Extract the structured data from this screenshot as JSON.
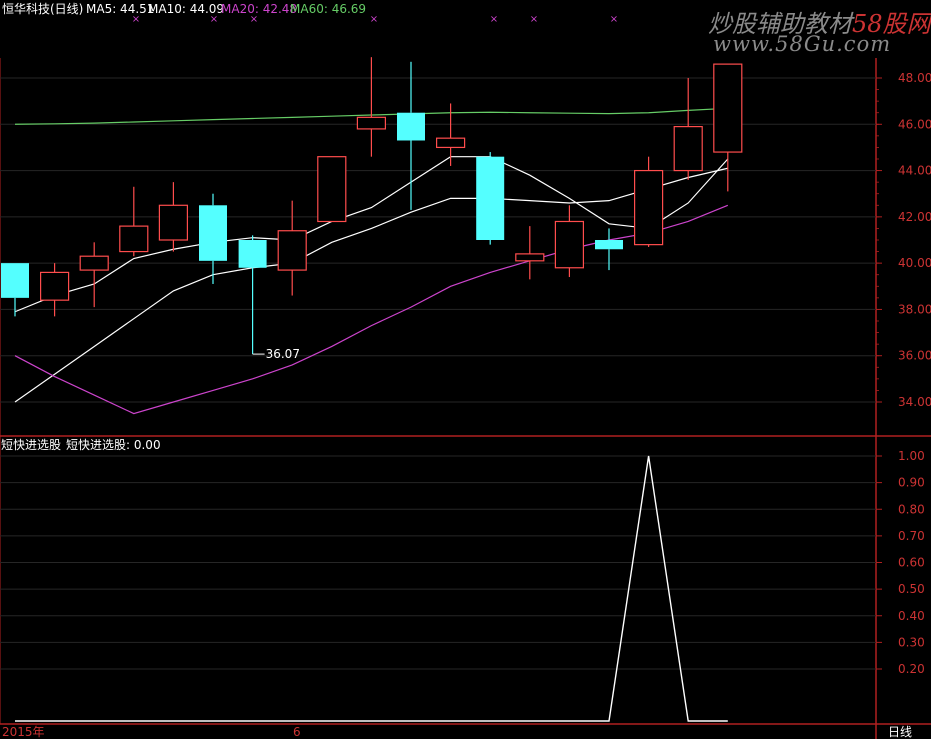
{
  "header": {
    "stock_label": "恒华科技(日线)",
    "ma5": "MA5: 44.51",
    "ma10": "MA10: 44.09",
    "ma20": "MA20: 42.48",
    "ma60": "MA60: 46.69",
    "colors": {
      "stock": "#ffffff",
      "ma5": "#ffffff",
      "ma10": "#ffffff",
      "ma20": "#cc44cc",
      "ma60": "#66cc66"
    }
  },
  "indicator_header": {
    "name": "短快进选股",
    "value_label": "短快进选股: 0.00"
  },
  "watermark": {
    "title_prefix": "炒股辅助教材",
    "title_red": "58股网",
    "url": "www.58Gu.com"
  },
  "bottom": {
    "year_label": "2015年",
    "month_label": "6",
    "period_button": "日线"
  },
  "chart_data": [
    {
      "type": "candlestick",
      "title": "恒华科技(日线)",
      "ylim": [
        33,
        50.5
      ],
      "y_ticks": [
        "48.00",
        "46.00",
        "44.00",
        "42.00",
        "40.00",
        "38.00",
        "36.00",
        "34.00"
      ],
      "low_annotation": {
        "label": "36.07",
        "candle_index": 6
      },
      "candles": [
        {
          "o": 40.0,
          "c": 38.5,
          "h": 40.0,
          "l": 37.7
        },
        {
          "o": 38.4,
          "c": 39.6,
          "h": 40.0,
          "l": 37.7
        },
        {
          "o": 39.7,
          "c": 40.3,
          "h": 40.9,
          "l": 38.1
        },
        {
          "o": 40.5,
          "c": 41.6,
          "h": 43.3,
          "l": 40.3
        },
        {
          "o": 41.0,
          "c": 42.5,
          "h": 43.5,
          "l": 40.5
        },
        {
          "o": 42.5,
          "c": 40.1,
          "h": 43.0,
          "l": 39.1
        },
        {
          "o": 41.0,
          "c": 39.8,
          "h": 41.2,
          "l": 36.07
        },
        {
          "o": 39.7,
          "c": 41.4,
          "h": 42.7,
          "l": 38.6
        },
        {
          "o": 41.8,
          "c": 44.6,
          "h": 44.6,
          "l": 41.8
        },
        {
          "o": 45.8,
          "c": 46.3,
          "h": 48.9,
          "l": 44.6
        },
        {
          "o": 46.5,
          "c": 45.3,
          "h": 48.7,
          "l": 42.3
        },
        {
          "o": 45.0,
          "c": 45.4,
          "h": 46.9,
          "l": 44.2
        },
        {
          "o": 44.6,
          "c": 41.0,
          "h": 44.8,
          "l": 40.8
        },
        {
          "o": 40.1,
          "c": 40.4,
          "h": 41.6,
          "l": 39.3
        },
        {
          "o": 39.8,
          "c": 41.8,
          "h": 42.5,
          "l": 39.4
        },
        {
          "o": 41.0,
          "c": 40.6,
          "h": 41.5,
          "l": 39.7
        },
        {
          "o": 40.8,
          "c": 44.0,
          "h": 44.6,
          "l": 40.7
        },
        {
          "o": 44.0,
          "c": 45.9,
          "h": 48.0,
          "l": 43.6
        },
        {
          "o": 44.8,
          "c": 48.6,
          "h": 48.6,
          "l": 43.1
        }
      ],
      "series": [
        {
          "name": "MA5",
          "color": "#ffffff",
          "values": [
            37.9,
            38.6,
            39.1,
            40.2,
            40.6,
            40.9,
            41.1,
            41.0,
            41.8,
            42.4,
            43.5,
            44.6,
            44.6,
            43.8,
            42.8,
            41.7,
            41.5,
            42.6,
            44.5
          ]
        },
        {
          "name": "MA10",
          "color": "#ffffff",
          "values": [
            34.0,
            35.2,
            36.4,
            37.6,
            38.8,
            39.5,
            39.8,
            40.0,
            40.9,
            41.5,
            42.2,
            42.8,
            42.8,
            42.7,
            42.6,
            42.7,
            43.2,
            43.7,
            44.1
          ]
        },
        {
          "name": "MA20",
          "color": "#cc44cc",
          "values": [
            36.0,
            35.1,
            34.3,
            33.5,
            34.0,
            34.5,
            35.0,
            35.6,
            36.4,
            37.3,
            38.1,
            39.0,
            39.6,
            40.1,
            40.6,
            41.0,
            41.3,
            41.8,
            42.5
          ]
        },
        {
          "name": "MA60",
          "color": "#66cc66",
          "values": [
            46.0,
            46.02,
            46.05,
            46.1,
            46.15,
            46.2,
            46.25,
            46.3,
            46.35,
            46.4,
            46.45,
            46.5,
            46.52,
            46.5,
            46.48,
            46.46,
            46.5,
            46.6,
            46.69
          ]
        }
      ]
    },
    {
      "type": "line",
      "title": "短快进选股",
      "ylim": [
        0,
        1.05
      ],
      "y_ticks": [
        "1.00",
        "0.90",
        "0.80",
        "0.70",
        "0.60",
        "0.50",
        "0.40",
        "0.30",
        "0.20"
      ],
      "series": [
        {
          "name": "短快进选股",
          "color": "#ffffff",
          "values": [
            0,
            0,
            0,
            0,
            0,
            0,
            0,
            0,
            0,
            0,
            0,
            0,
            0,
            0,
            0,
            0,
            1,
            0,
            0
          ]
        }
      ]
    }
  ]
}
